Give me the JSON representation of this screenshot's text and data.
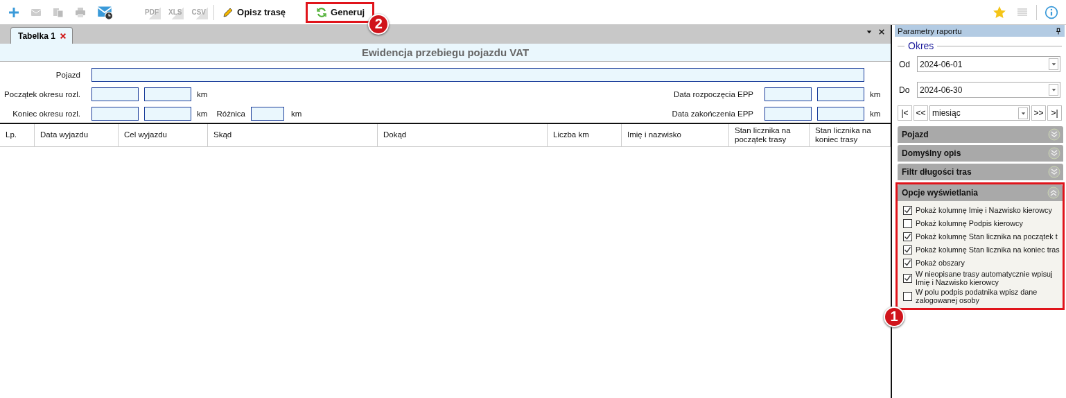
{
  "toolbar": {
    "exports": [
      "PDF",
      "XLS",
      "CSV"
    ],
    "describe": "Opisz trasę",
    "generate": {
      "label": "Generuj",
      "highlighted": true,
      "callout": "2"
    }
  },
  "tabs": [
    {
      "label": "Tabelka 1",
      "selected": true
    }
  ],
  "report": {
    "title": "Ewidencja przebiegu pojazdu VAT",
    "vehicle_label": "Pojazd",
    "start_label": "Początek okresu rozl.",
    "end_label": "Koniec okresu rozl.",
    "start_unit": "km",
    "end_unit": "km",
    "diff_unit": "km",
    "epp_start_unit": "km",
    "epp_end_unit": "km",
    "diff_label": "Różnica",
    "epp_start_label": "Data rozpoczęcia EPP",
    "epp_end_label": "Data zakończenia EPP"
  },
  "table": {
    "columns": [
      "Lp.",
      "Data wyjazdu",
      "Cel wyjazdu",
      "Skąd",
      "Dokąd",
      "Liczba km",
      "Imię i nazwisko",
      "Stan licznika na początek trasy",
      "Stan licznika na koniec trasy"
    ]
  },
  "panel": {
    "title": "Parametry raportu",
    "period_label": "Okres",
    "from_label": "Od",
    "from": "2024-06-01",
    "to_label": "Do",
    "to": "2024-06-30",
    "nav": [
      "|<",
      "<<",
      ">>",
      ">|"
    ],
    "range": "miesiąc",
    "sections": [
      {
        "title": "Pojazd",
        "expanded": false,
        "highlighted": false
      },
      {
        "title": "Domyślny opis",
        "expanded": false,
        "highlighted": false
      },
      {
        "title": "Filtr długości tras",
        "expanded": false,
        "highlighted": false
      },
      {
        "title": "Opcje wyświetlania",
        "expanded": true,
        "highlighted": true,
        "callout": "1"
      }
    ],
    "options": [
      {
        "label": "Pokaż kolumnę Imię i Nazwisko kierowcy",
        "checked": true
      },
      {
        "label": "Pokaż kolumnę Podpis kierowcy",
        "checked": false
      },
      {
        "label": "Pokaż kolumnę Stan licznika na początek t",
        "checked": true
      },
      {
        "label": "Pokaż kolumnę Stan licznika na koniec tras",
        "checked": true
      },
      {
        "label": "Pokaż obszary",
        "checked": true
      },
      {
        "label": "W nieopisane trasy automatycznie wpisuj Imię i Nazwisko kierowcy",
        "checked": true
      },
      {
        "label": "W polu podpis podatnika wpisz dane zalogowanej osoby",
        "checked": false
      }
    ]
  }
}
